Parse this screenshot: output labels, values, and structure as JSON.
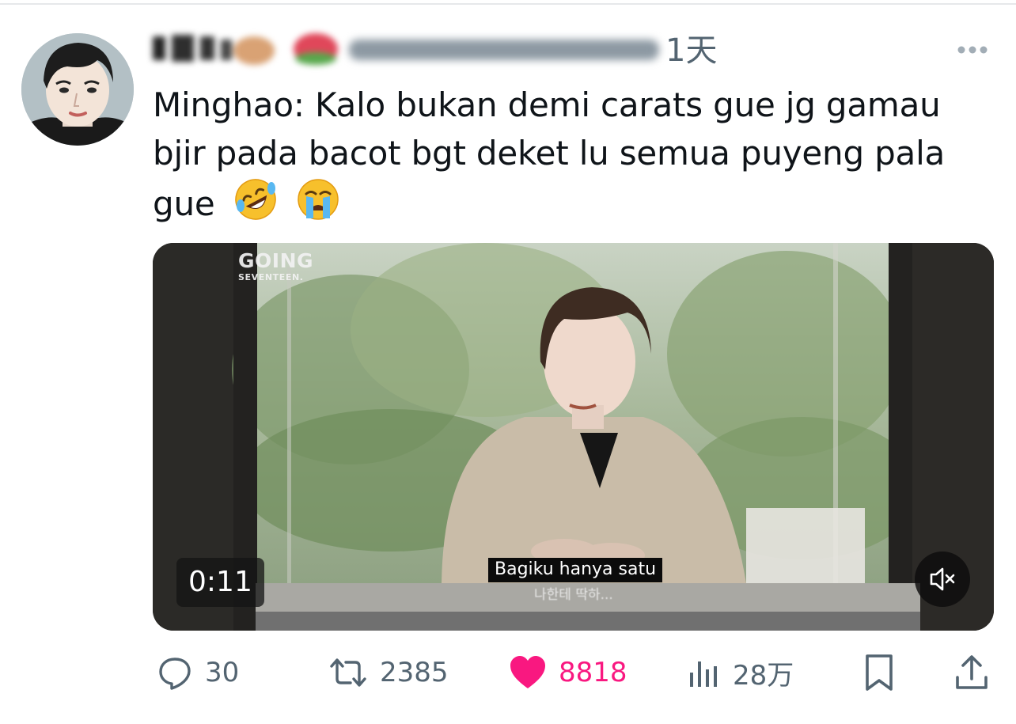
{
  "tweet": {
    "time": "1天",
    "text": "Minghao: Kalo bukan demi carats gue jg gamau bjir pada bacot bgt deket lu semua puyeng pala gue",
    "emojis": [
      "rolling-on-floor-laughing",
      "loudly-crying-face"
    ]
  },
  "media": {
    "logo_line1": "GOING",
    "logo_line2": "SEVENTEEN.",
    "subtitle": "Bagiku hanya satu",
    "subtitle_korean": "나한테 딱하...",
    "duration": "0:11",
    "muted": true
  },
  "actions": {
    "replies": "30",
    "retweets": "2385",
    "likes": "8818",
    "liked": true,
    "views": "28万"
  },
  "colors": {
    "text": "#0f1419",
    "muted": "#536471",
    "like": "#f91880"
  }
}
